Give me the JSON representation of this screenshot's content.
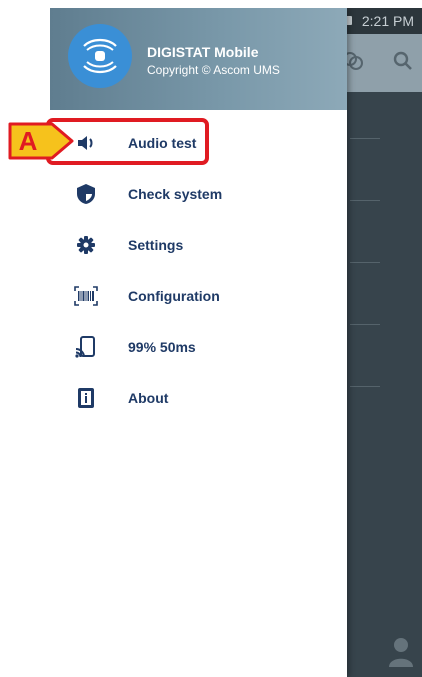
{
  "status_bar": {
    "time": "2:21 PM"
  },
  "drawer": {
    "app_name": "DIGISTAT Mobile",
    "copyright": "Copyright © Ascom UMS",
    "items": [
      {
        "label": "Audio test",
        "icon": "speaker-icon"
      },
      {
        "label": "Check system",
        "icon": "shield-icon"
      },
      {
        "label": "Settings",
        "icon": "gear-icon"
      },
      {
        "label": "Configuration",
        "icon": "barcode-scan-icon"
      },
      {
        "label": "99% 50ms",
        "icon": "cast-signal-icon"
      },
      {
        "label": "About",
        "icon": "info-icon"
      }
    ]
  },
  "annotation": {
    "callout_letter": "A"
  },
  "colors": {
    "accent_blue": "#3a8fd6",
    "label_navy": "#1f3a66",
    "highlight_red": "#e01b22",
    "callout_yellow": "#f6c21c"
  }
}
